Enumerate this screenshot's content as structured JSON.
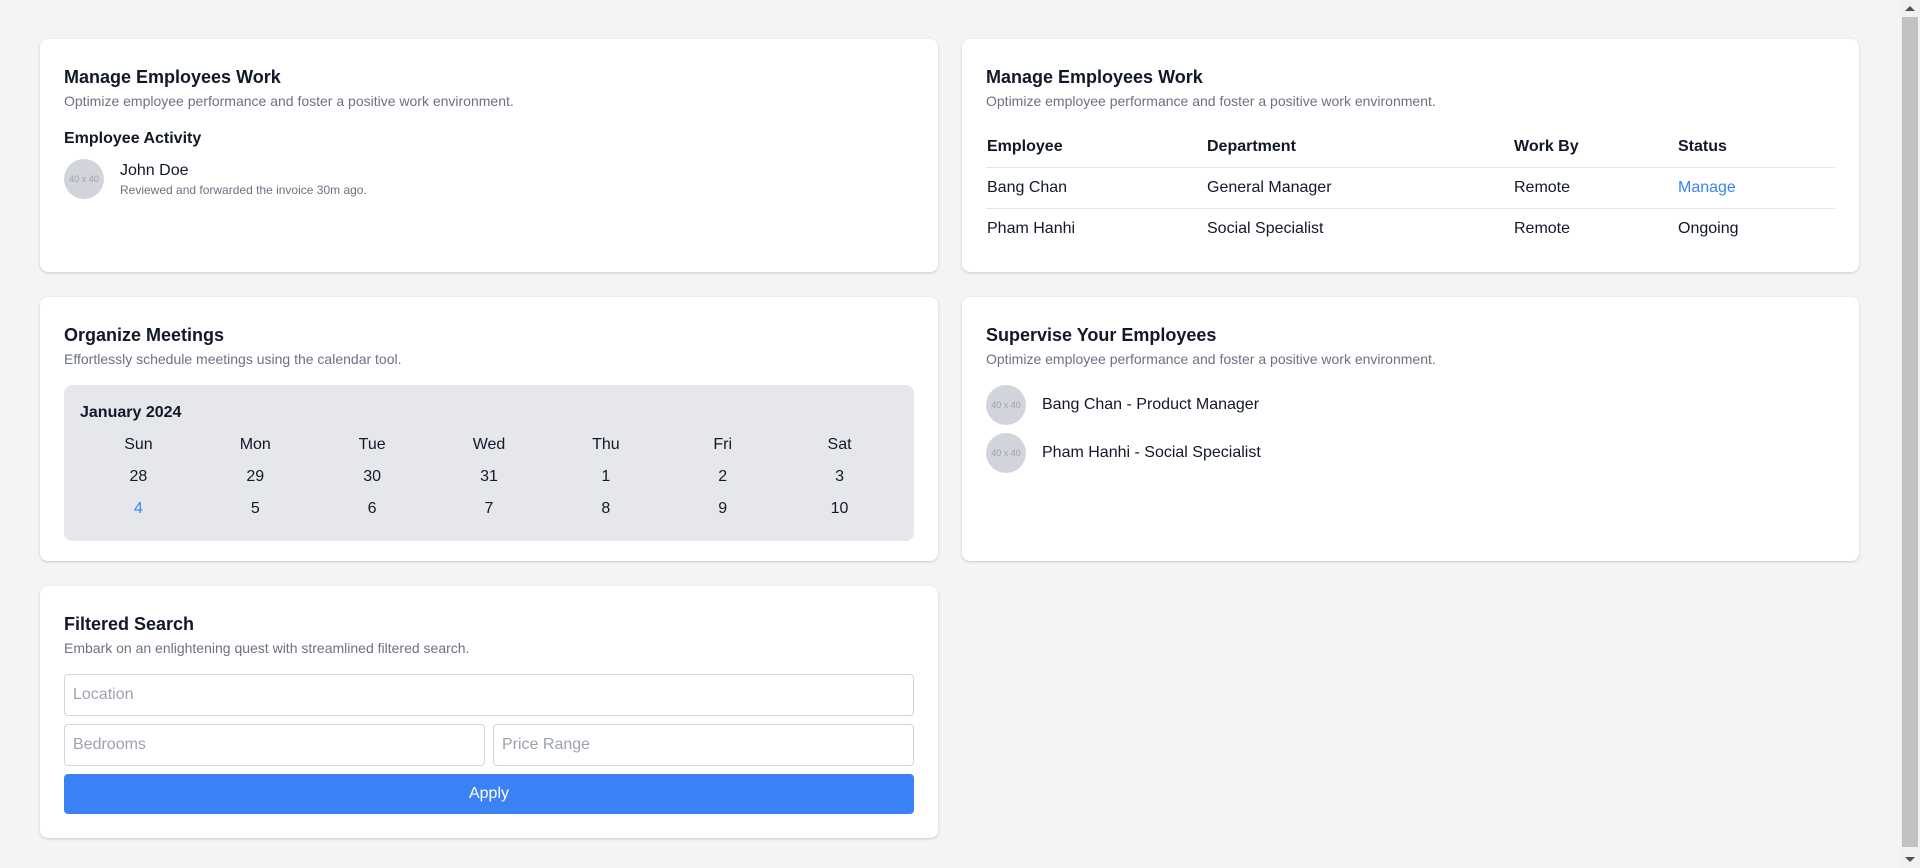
{
  "manage_activity": {
    "title": "Manage Employees Work",
    "subtitle": "Optimize employee performance and foster a positive work environment.",
    "section_title": "Employee Activity",
    "items": [
      {
        "avatar": "40 x 40",
        "name": "John Doe",
        "description": "Reviewed and forwarded the invoice 30m ago."
      }
    ]
  },
  "manage_table": {
    "title": "Manage Employees Work",
    "subtitle": "Optimize employee performance and foster a positive work environment.",
    "headers": [
      "Employee",
      "Department",
      "Work By",
      "Status"
    ],
    "rows": [
      [
        "Bang Chan",
        "General Manager",
        "Remote",
        "Manage"
      ],
      [
        "Pham Hanhi",
        "Social Specialist",
        "Remote",
        "Ongoing"
      ]
    ]
  },
  "meetings": {
    "title": "Organize Meetings",
    "subtitle": "Effortlessly schedule meetings using the calendar tool.",
    "month": "January 2024",
    "weekdays": [
      "Sun",
      "Mon",
      "Tue",
      "Wed",
      "Thu",
      "Fri",
      "Sat"
    ],
    "weeks": [
      [
        "28",
        "29",
        "30",
        "31",
        "1",
        "2",
        "3"
      ],
      [
        "4",
        "5",
        "6",
        "7",
        "8",
        "9",
        "10"
      ]
    ],
    "highlight_color": "#3b82f6"
  },
  "supervise": {
    "title": "Supervise Your Employees",
    "subtitle": "Optimize employee performance and foster a positive work environment.",
    "items": [
      {
        "avatar": "40 x 40",
        "label": "Bang Chan - Product Manager"
      },
      {
        "avatar": "40 x 40",
        "label": "Pham Hanhi - Social Specialist"
      }
    ]
  },
  "search": {
    "title": "Filtered Search",
    "subtitle": "Embark on an enlightening quest with streamlined filtered search.",
    "location_placeholder": "Location",
    "bedrooms_placeholder": "Bedrooms",
    "price_placeholder": "Price Range",
    "apply_label": "Apply"
  },
  "colors": {
    "accent": "#3b82f6",
    "background": "#f3f4f6"
  }
}
